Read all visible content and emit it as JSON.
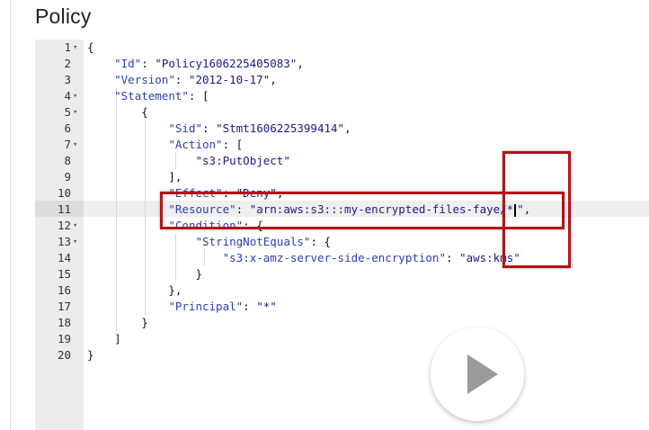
{
  "page": {
    "title": "Policy"
  },
  "editor": {
    "active_line": "11",
    "lines": [
      {
        "n": "1",
        "fold": "▾",
        "t": "{"
      },
      {
        "n": "2",
        "fold": "",
        "t": "    \"Id\": \"Policy1606225405083\","
      },
      {
        "n": "3",
        "fold": "",
        "t": "    \"Version\": \"2012-10-17\","
      },
      {
        "n": "4",
        "fold": "▾",
        "t": "    \"Statement\": ["
      },
      {
        "n": "5",
        "fold": "▾",
        "t": "        {"
      },
      {
        "n": "6",
        "fold": "",
        "t": "            \"Sid\": \"Stmt1606225399414\","
      },
      {
        "n": "7",
        "fold": "▾",
        "t": "            \"Action\": ["
      },
      {
        "n": "8",
        "fold": "",
        "t": "                \"s3:PutObject\""
      },
      {
        "n": "9",
        "fold": "",
        "t": "            ],"
      },
      {
        "n": "10",
        "fold": "",
        "t": "            \"Effect\": \"Deny\","
      },
      {
        "n": "11",
        "fold": "",
        "t": "            \"Resource\": \"arn:aws:s3:::my-encrypted-files-faye/*\","
      },
      {
        "n": "12",
        "fold": "▾",
        "t": "            \"Condition\": {"
      },
      {
        "n": "13",
        "fold": "▾",
        "t": "                \"StringNotEquals\": {"
      },
      {
        "n": "14",
        "fold": "",
        "t": "                    \"s3:x-amz-server-side-encryption\": \"aws:kms\""
      },
      {
        "n": "15",
        "fold": "",
        "t": "                }"
      },
      {
        "n": "16",
        "fold": "",
        "t": "            },"
      },
      {
        "n": "17",
        "fold": "",
        "t": "            \"Principal\": \"*\""
      },
      {
        "n": "18",
        "fold": "",
        "t": "        }"
      },
      {
        "n": "19",
        "fold": "",
        "t": "    ]"
      },
      {
        "n": "20",
        "fold": "",
        "t": "}"
      }
    ]
  },
  "annotations": {
    "color": "#b0151a"
  },
  "video_overlay": {
    "icon": "play-icon"
  }
}
